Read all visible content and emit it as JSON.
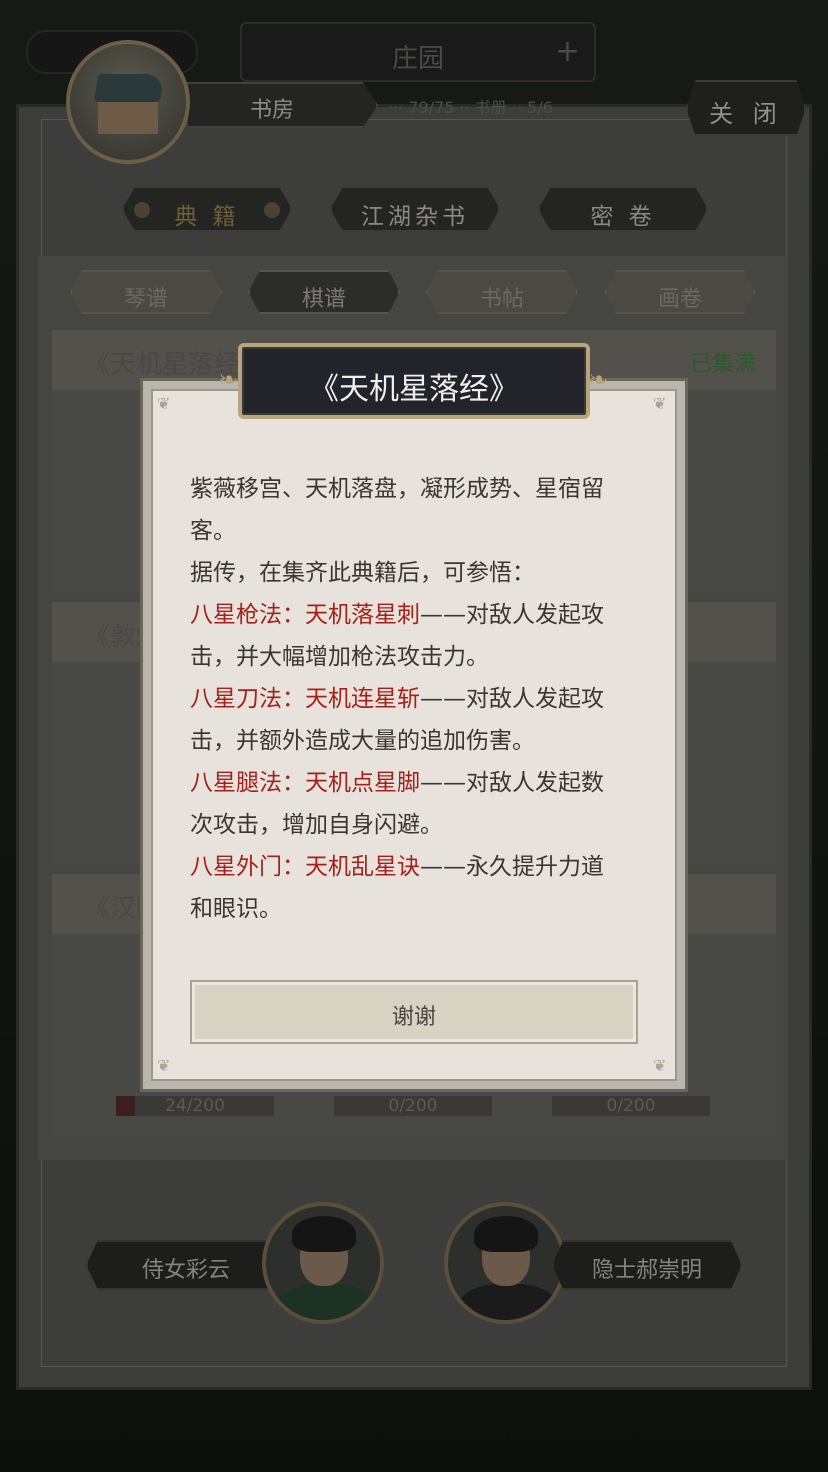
{
  "header": {
    "location": "庄园",
    "plus": "+"
  },
  "building": {
    "name": "书房",
    "close_label": "关 闭",
    "faint_info": "··· 79/75 ·· 书册 ·· 5/6"
  },
  "categories": [
    {
      "label": "典 籍",
      "active": true
    },
    {
      "label": "江湖杂书",
      "active": false
    },
    {
      "label": "密 卷",
      "active": false
    }
  ],
  "subtabs": [
    {
      "label": "琴谱"
    },
    {
      "label": "棋谱"
    },
    {
      "label": "书帖"
    },
    {
      "label": "画卷"
    }
  ],
  "books": [
    {
      "name": "《天机星落经",
      "status": "已集满"
    },
    {
      "name": "《敦煌"
    },
    {
      "name": "《汉图"
    }
  ],
  "progress_row3": [
    {
      "label": "24/200",
      "value": 24,
      "max": 200
    },
    {
      "label": "0/200",
      "value": 0,
      "max": 200
    },
    {
      "label": "0/200",
      "value": 0,
      "max": 200
    }
  ],
  "npcs": [
    {
      "name": "侍女彩云"
    },
    {
      "name": "隐士郝崇明"
    }
  ],
  "modal": {
    "title": "《天机星落经》",
    "intro_1": "紫薇移宫、天机落盘，凝形成势、星宿留",
    "intro_2": "客。",
    "intro_3": "据传，在集齐此典籍后，可参悟：",
    "skills": [
      {
        "name": "八星枪法：天机落星刺",
        "desc_1": "——对敌人发起攻",
        "desc_2": "击，并大幅增加枪法攻击力。"
      },
      {
        "name": "八星刀法：天机连星斩",
        "desc_1": "——对敌人发起攻",
        "desc_2": "击，并额外造成大量的追加伤害。"
      },
      {
        "name": "八星腿法：天机点星脚",
        "desc_1": "——对敌人发起数",
        "desc_2": "次攻击，增加自身闪避。"
      },
      {
        "name": "八星外门：天机乱星诀",
        "desc_1": "——永久提升力道",
        "desc_2": "和眼识。"
      }
    ],
    "button_label": "谢谢"
  },
  "colors": {
    "skill_red": "#a5211a",
    "modal_bg": "#e7e2dc",
    "title_bg": "#22232b",
    "title_border": "#b8a57c"
  }
}
